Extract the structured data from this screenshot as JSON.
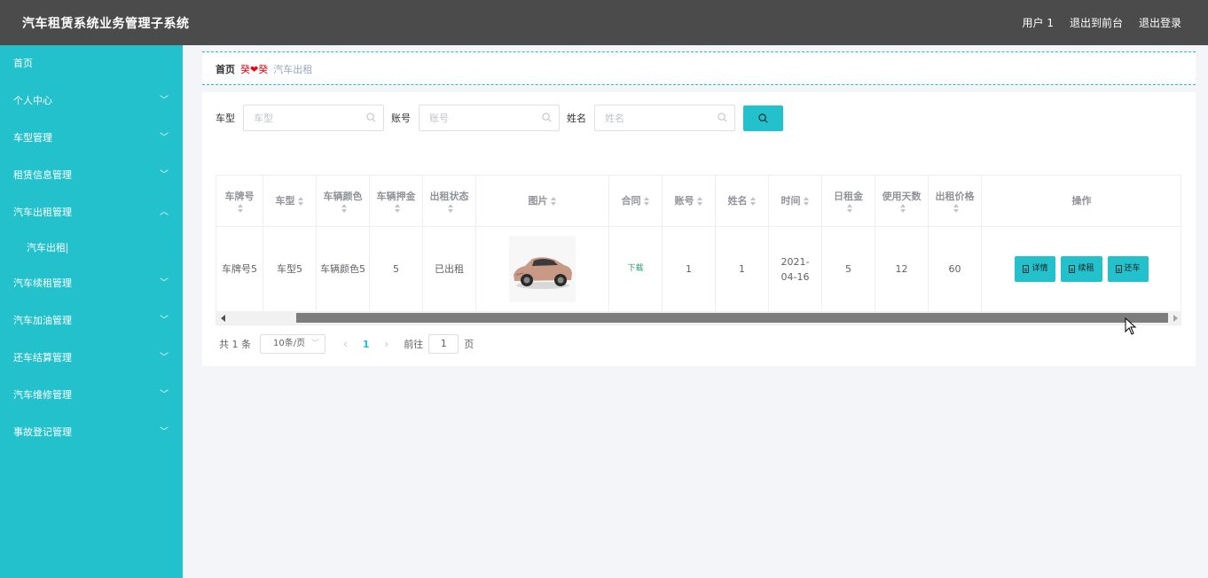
{
  "header": {
    "title": "汽车租赁系统业务管理子系统",
    "user": "用户 1",
    "to_front": "退出到前台",
    "logout": "退出登录"
  },
  "sidebar": {
    "items": [
      {
        "label": "首页",
        "expandable": false
      },
      {
        "label": "个人中心",
        "expandable": true
      },
      {
        "label": "车型管理",
        "expandable": true
      },
      {
        "label": "租赁信息管理",
        "expandable": true
      },
      {
        "label": "汽车出租管理",
        "expandable": true,
        "expanded": true
      },
      {
        "label": "汽车出租",
        "sub": true
      },
      {
        "label": "汽车续租管理",
        "expandable": true
      },
      {
        "label": "汽车加油管理",
        "expandable": true
      },
      {
        "label": "还车结算管理",
        "expandable": true
      },
      {
        "label": "汽车维修管理",
        "expandable": true
      },
      {
        "label": "事故登记管理",
        "expandable": true
      }
    ]
  },
  "breadcrumb": {
    "home": "首页",
    "separator": "癸❤癸",
    "current": "汽车出租"
  },
  "search": {
    "fields": [
      {
        "label": "车型",
        "placeholder": "车型"
      },
      {
        "label": "账号",
        "placeholder": "账号"
      },
      {
        "label": "姓名",
        "placeholder": "姓名"
      }
    ]
  },
  "table": {
    "columns": [
      {
        "label": "车牌号",
        "sortable": true
      },
      {
        "label": "车型",
        "sortable": true
      },
      {
        "label": "车辆颜色",
        "sortable": true
      },
      {
        "label": "车辆押金",
        "sortable": true
      },
      {
        "label": "出租状态",
        "sortable": true
      },
      {
        "label": "图片",
        "sortable": true
      },
      {
        "label": "合同",
        "sortable": true
      },
      {
        "label": "账号",
        "sortable": true
      },
      {
        "label": "姓名",
        "sortable": true
      },
      {
        "label": "时间",
        "sortable": true
      },
      {
        "label": "日租金",
        "sortable": true
      },
      {
        "label": "使用天数",
        "sortable": true
      },
      {
        "label": "出租价格",
        "sortable": true
      },
      {
        "label": "操作",
        "sortable": false
      }
    ],
    "rows": [
      {
        "plate": "车牌号5",
        "model": "车型5",
        "color": "车辆颜色5",
        "deposit": "5",
        "status": "已出租",
        "contract": "下载",
        "account": "1",
        "name": "1",
        "time": "2021-04-16",
        "daily_rent": "5",
        "days": "12",
        "price": "60",
        "actions": [
          "详情",
          "续租",
          "还车"
        ]
      }
    ]
  },
  "pagination": {
    "total": "共 1 条",
    "page_size": "10条/页",
    "current": "1",
    "goto_label": "前往",
    "goto_value": "1",
    "page_unit": "页"
  },
  "colors": {
    "accent": "#22c1cc",
    "header_bg": "#4b4b4b"
  }
}
